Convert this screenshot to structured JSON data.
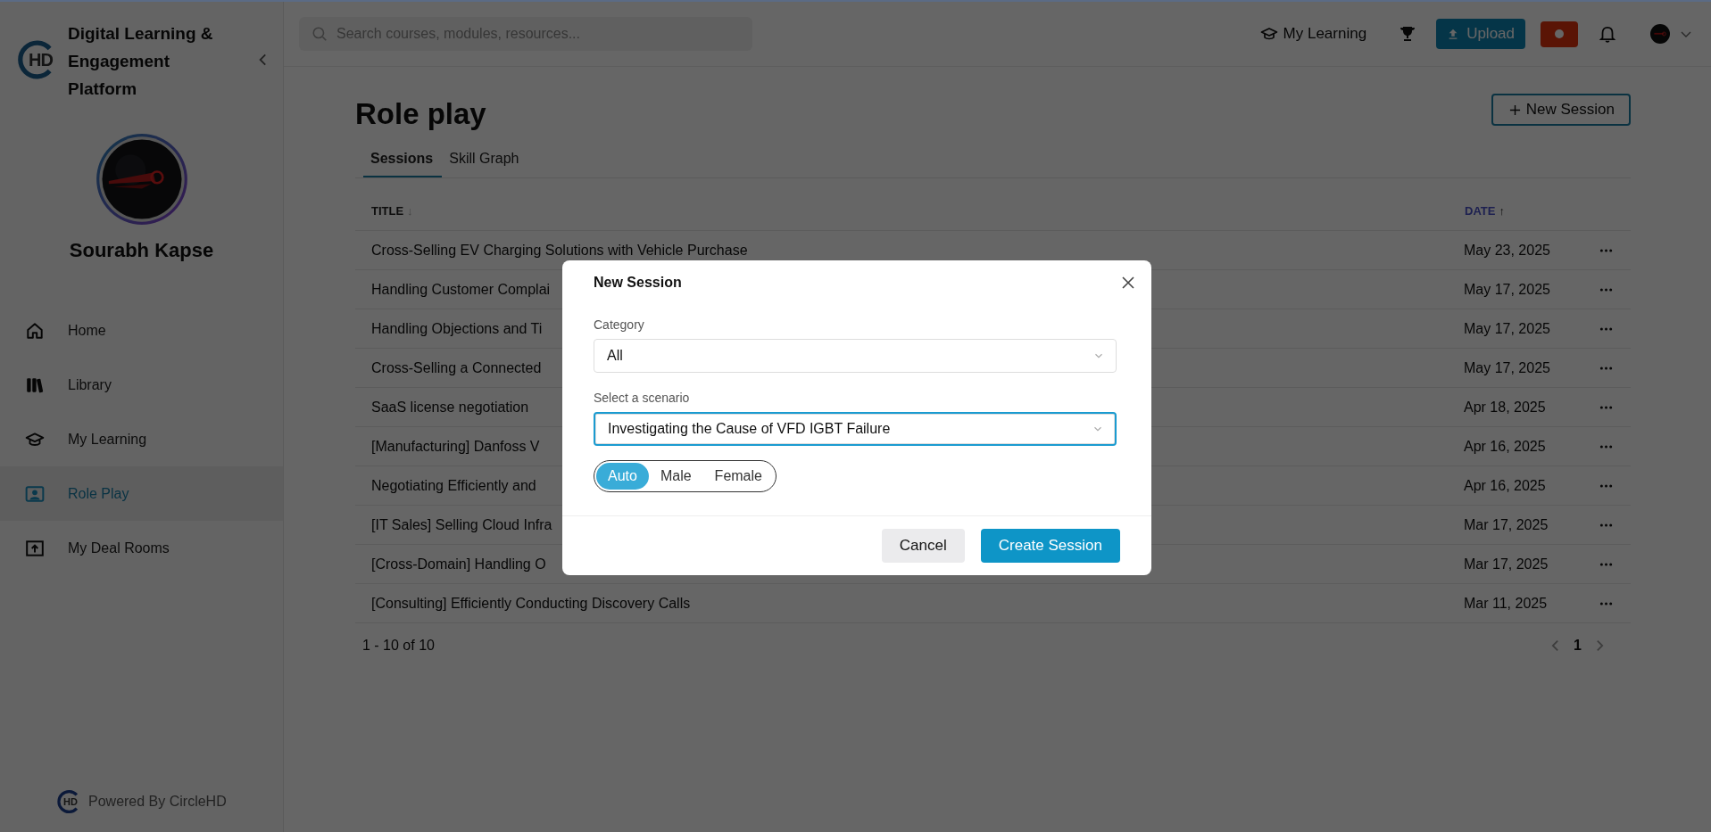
{
  "app": {
    "logo_text": "HD",
    "title": "Digital Learning & Engagement Platform",
    "user_name": "Sourabh Kapse",
    "footer_logo_text": "HD",
    "footer": "Powered By CircleHD"
  },
  "sidebar": {
    "items": [
      {
        "label": "Home",
        "kind": "home",
        "selected": false
      },
      {
        "label": "Library",
        "kind": "library",
        "selected": false
      },
      {
        "label": "My Learning",
        "kind": "learning",
        "selected": false
      },
      {
        "label": "Role Play",
        "kind": "roleplay",
        "selected": true
      },
      {
        "label": "My Deal Rooms",
        "kind": "dealrooms",
        "selected": false
      }
    ]
  },
  "top_bar": {
    "search": {
      "placeholder": "Search courses, modules, resources..."
    },
    "my_learning": "My Learning",
    "upload": "Upload"
  },
  "page": {
    "title": "Role play",
    "new_session": "New Session",
    "tabs": [
      {
        "label": "Sessions",
        "selected": true
      },
      {
        "label": "Skill Graph",
        "selected": false
      }
    ]
  },
  "table": {
    "columns": [
      {
        "label": "TITLE",
        "sort_arrow": "↓",
        "active": false
      },
      {
        "label": "DATE",
        "sort_arrow": "↑",
        "active": true
      }
    ],
    "rows": [
      {
        "title": "Cross-Selling EV Charging Solutions with Vehicle Purchase",
        "date": "May 23, 2025"
      },
      {
        "title": "Handling Customer Complai",
        "date": "May 17, 2025"
      },
      {
        "title": "Handling Objections and Ti",
        "date": "May 17, 2025"
      },
      {
        "title": "Cross-Selling a Connected",
        "date": "May 17, 2025"
      },
      {
        "title": "SaaS license negotiation",
        "date": "Apr 18, 2025"
      },
      {
        "title": "[Manufacturing] Danfoss V",
        "date": "Apr 16, 2025"
      },
      {
        "title": "Negotiating Efficiently and",
        "date": "Apr 16, 2025"
      },
      {
        "title": "[IT Sales] Selling Cloud Infra",
        "date": "Mar 17, 2025"
      },
      {
        "title": "[Cross-Domain] Handling O",
        "date": "Mar 17, 2025"
      },
      {
        "title": "[Consulting] Efficiently Conducting Discovery Calls",
        "date": "Mar 11, 2025"
      }
    ],
    "range": "1 - 10 of 10",
    "page": "1"
  },
  "dialog": {
    "title": "New Session",
    "category": {
      "label": "Category",
      "value": "All",
      "focused": false
    },
    "scenario": {
      "label": "Select a scenario",
      "value": "Investigating the Cause of VFD IGBT Failure",
      "focused": true
    },
    "voices": [
      {
        "label": "Auto",
        "selected": true
      },
      {
        "label": "Male",
        "selected": false
      },
      {
        "label": "Female",
        "selected": false
      }
    ],
    "cancel": "Cancel",
    "create": "Create Session"
  }
}
